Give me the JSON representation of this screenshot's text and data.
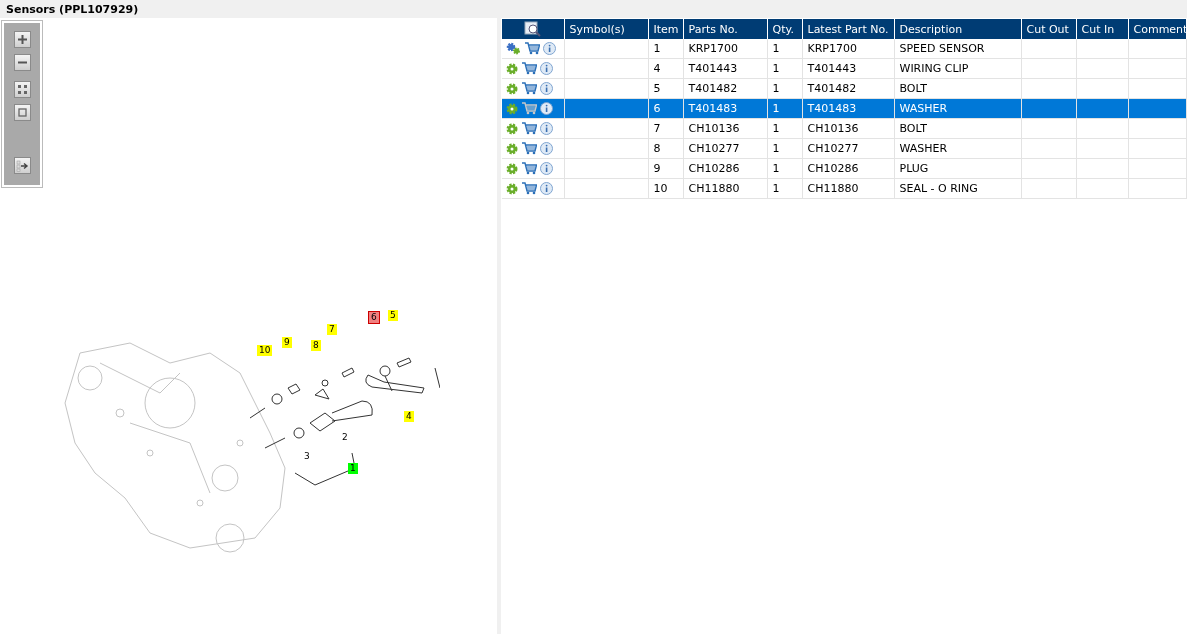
{
  "window": {
    "title": "Sensors (PPL107929)"
  },
  "diagram": {
    "callouts": [
      {
        "label": "10",
        "kind": "tag",
        "color": "#ffff00",
        "selected": false
      },
      {
        "label": "9",
        "kind": "tag",
        "color": "#ffff00",
        "selected": false
      },
      {
        "label": "8",
        "kind": "tag",
        "color": "#ffff00",
        "selected": false
      },
      {
        "label": "7",
        "kind": "tag",
        "color": "#ffff00",
        "selected": false
      },
      {
        "label": "6",
        "kind": "tag",
        "color": "#f08080",
        "selected": true
      },
      {
        "label": "5",
        "kind": "tag",
        "color": "#ffff00",
        "selected": false
      },
      {
        "label": "4",
        "kind": "tag",
        "color": "#ffff00",
        "selected": false
      },
      {
        "label": "3",
        "kind": "plain"
      },
      {
        "label": "2",
        "kind": "plain"
      },
      {
        "label": "1",
        "kind": "tag",
        "color": "#00ff00",
        "selected": false
      }
    ]
  },
  "table": {
    "columns": [
      "Symbol(s)",
      "Item",
      "Parts No.",
      "Qty.",
      "Latest Part No.",
      "Description",
      "Cut Out",
      "Cut In",
      "Comment"
    ],
    "rows": [
      {
        "kind": "assembly",
        "selected": false,
        "cells": [
          "",
          "1",
          "KRP1700",
          "1",
          "KRP1700",
          "SPEED SENSOR",
          "",
          "",
          ""
        ]
      },
      {
        "kind": "part",
        "selected": false,
        "cells": [
          "",
          "4",
          "T401443",
          "1",
          "T401443",
          "WIRING CLIP",
          "",
          "",
          ""
        ]
      },
      {
        "kind": "part",
        "selected": false,
        "cells": [
          "",
          "5",
          "T401482",
          "1",
          "T401482",
          "BOLT",
          "",
          "",
          ""
        ]
      },
      {
        "kind": "part",
        "selected": true,
        "cells": [
          "",
          "6",
          "T401483",
          "1",
          "T401483",
          "WASHER",
          "",
          "",
          ""
        ]
      },
      {
        "kind": "part",
        "selected": false,
        "cells": [
          "",
          "7",
          "CH10136",
          "1",
          "CH10136",
          "BOLT",
          "",
          "",
          ""
        ]
      },
      {
        "kind": "part",
        "selected": false,
        "cells": [
          "",
          "8",
          "CH10277",
          "1",
          "CH10277",
          "WASHER",
          "",
          "",
          ""
        ]
      },
      {
        "kind": "part",
        "selected": false,
        "cells": [
          "",
          "9",
          "CH10286",
          "1",
          "CH10286",
          "PLUG",
          "",
          "",
          ""
        ]
      },
      {
        "kind": "part",
        "selected": false,
        "cells": [
          "",
          "10",
          "CH11880",
          "1",
          "CH11880",
          "SEAL - O RING",
          "",
          "",
          ""
        ]
      }
    ]
  }
}
